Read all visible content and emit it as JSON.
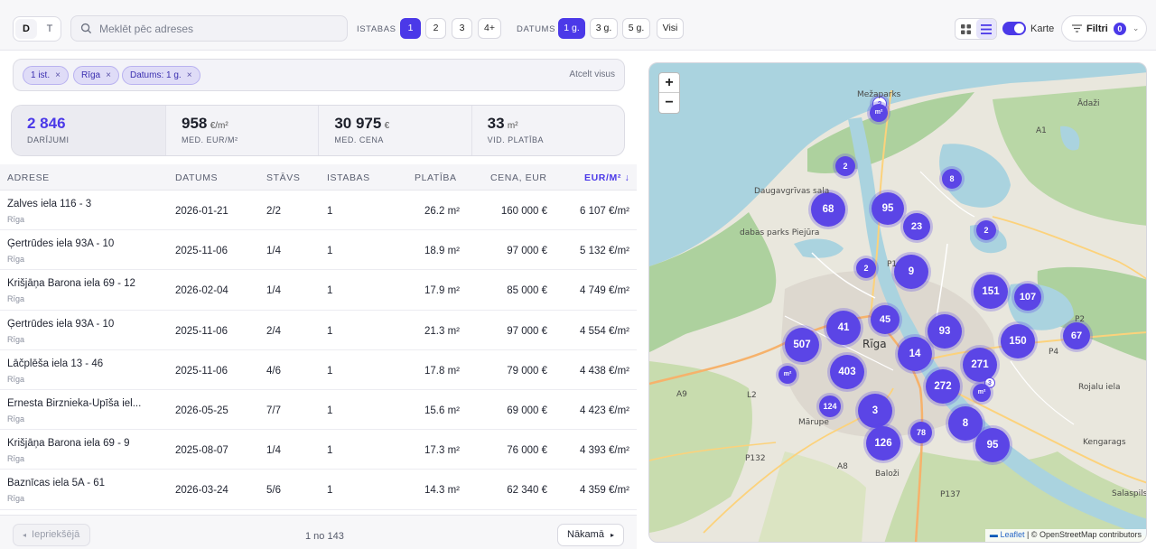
{
  "toolbar": {
    "segments": [
      "D",
      "T"
    ],
    "search_placeholder": "Meklēt pēc adreses",
    "rooms_label": "ISTABAS",
    "rooms": [
      "1",
      "2",
      "3",
      "4+"
    ],
    "date_label": "DATUMS",
    "dates": [
      "1 g.",
      "3 g.",
      "5 g.",
      "Visi"
    ],
    "map_toggle_label": "Karte",
    "filters_label": "Filtri",
    "filters_count": "0"
  },
  "chips": {
    "items": [
      "1 ist.",
      "Rīga",
      "Datums: 1 g."
    ],
    "clear_all": "Atcelt visus"
  },
  "stats": [
    {
      "value": "2 846",
      "unit": "",
      "label": "DARĪJUMI"
    },
    {
      "value": "958",
      "unit": "€/m²",
      "label": "MED. EUR/M²"
    },
    {
      "value": "30 975",
      "unit": "€",
      "label": "MED. CENA"
    },
    {
      "value": "33",
      "unit": "m²",
      "label": "VID. PLATĪBA"
    }
  ],
  "table": {
    "headers": [
      "ADRESE",
      "DATUMS",
      "STĀVS",
      "ISTABAS",
      "PLATĪBA",
      "CENA, EUR",
      "EUR/M² ↓"
    ],
    "rows": [
      {
        "address": "Zalves iela 116 - 3",
        "city": "Rīga",
        "date": "2026-01-21",
        "floor": "2/2",
        "rooms": "1",
        "area": "26.2 m²",
        "price": "160 000 €",
        "ppm": "6 107 €/m²"
      },
      {
        "address": "Ģertrūdes iela 93A - 10",
        "city": "Rīga",
        "date": "2025-11-06",
        "floor": "1/4",
        "rooms": "1",
        "area": "18.9 m²",
        "price": "97 000 €",
        "ppm": "5 132 €/m²"
      },
      {
        "address": "Krišjāņa Barona iela 69 - 12",
        "city": "Rīga",
        "date": "2026-02-04",
        "floor": "1/4",
        "rooms": "1",
        "area": "17.9 m²",
        "price": "85 000 €",
        "ppm": "4 749 €/m²"
      },
      {
        "address": "Ģertrūdes iela 93A - 10",
        "city": "Rīga",
        "date": "2025-11-06",
        "floor": "2/4",
        "rooms": "1",
        "area": "21.3 m²",
        "price": "97 000 €",
        "ppm": "4 554 €/m²"
      },
      {
        "address": "Lāčplēša iela 13 - 46",
        "city": "Rīga",
        "date": "2025-11-06",
        "floor": "4/6",
        "rooms": "1",
        "area": "17.8 m²",
        "price": "79 000 €",
        "ppm": "4 438 €/m²"
      },
      {
        "address": "Ernesta Birznieka-Upīša iel...",
        "city": "Rīga",
        "date": "2026-05-25",
        "floor": "7/7",
        "rooms": "1",
        "area": "15.6 m²",
        "price": "69 000 €",
        "ppm": "4 423 €/m²"
      },
      {
        "address": "Krišjāņa Barona iela 69 - 9",
        "city": "Rīga",
        "date": "2025-08-07",
        "floor": "1/4",
        "rooms": "1",
        "area": "17.3 m²",
        "price": "76 000 €",
        "ppm": "4 393 €/m²"
      },
      {
        "address": "Baznīcas iela 5A - 61",
        "city": "Rīga",
        "date": "2026-03-24",
        "floor": "5/6",
        "rooms": "1",
        "area": "14.3 m²",
        "price": "62 340 €",
        "ppm": "4 359 €/m²"
      }
    ]
  },
  "pager": {
    "prev": "Iepriekšējā",
    "info": "1 no 143",
    "next": "Nākamā"
  },
  "map": {
    "zoom_in": "+",
    "zoom_out": "−",
    "clusters": [
      "2",
      "2",
      "8",
      "68",
      "95",
      "23",
      "2",
      "2",
      "9",
      "151",
      "107",
      "45",
      "41",
      "93",
      "507",
      "150",
      "67",
      "14",
      "271",
      "403",
      "272",
      "124",
      "3",
      "78",
      "8",
      "126",
      "95",
      "75"
    ],
    "labels": [
      "Rīga",
      "Mārupe",
      "Baloži",
      "Salaspils",
      "Ādaži",
      "Daugavgrīvas sala",
      "dabas parks Piejūra",
      "A9",
      "L2",
      "P132",
      "A8",
      "P137",
      "P4",
      "P2",
      "P1",
      "A1",
      "Rojalu iela",
      "Mežaparks",
      "Kengarags"
    ],
    "attribution_leaflet": "Leaflet",
    "attribution_rest": " | © OpenStreetMap contributors"
  }
}
